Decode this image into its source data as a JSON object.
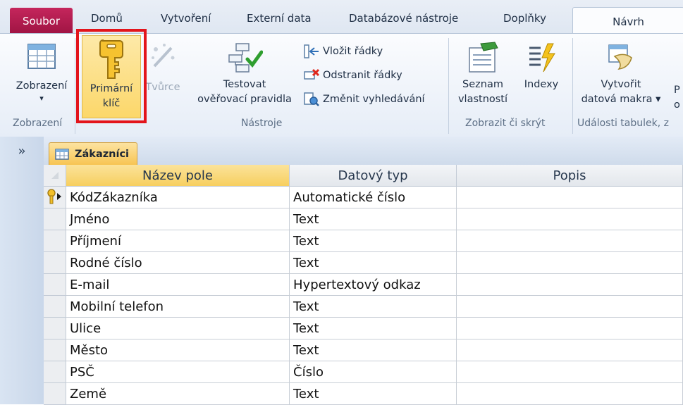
{
  "ribbon_tabs": {
    "file": "Soubor",
    "home": "Domů",
    "create": "Vytvoření",
    "external": "Externí data",
    "dbtools": "Databázové nástroje",
    "addins": "Doplňky",
    "design": "Návrh"
  },
  "ribbon": {
    "view": {
      "line1": "Zobrazení",
      "arrow": "▾",
      "group": "Zobrazení"
    },
    "primary_key": {
      "line1": "Primární",
      "line2": "klíč"
    },
    "builder": {
      "line1": "Tvůrce"
    },
    "test_rules": {
      "line1": "Testovat",
      "line2": "ověřovací pravidla"
    },
    "insert_rows": "Vložit řádky",
    "delete_rows": "Odstranit řádky",
    "modify_lookups": "Změnit vyhledávání",
    "tools_group": "Nástroje",
    "property_sheet": {
      "line1": "Seznam",
      "line2": "vlastností"
    },
    "indexes": {
      "line1": "Indexy"
    },
    "showhide_group": "Zobrazit či skrýt",
    "create_macros": {
      "line1": "Vytvořit",
      "line2": "datová makra ▾"
    },
    "cut_next_line1": "P",
    "cut_next_line2": "o",
    "events_group": "Události tabulek, z"
  },
  "nav": {
    "toggle": "»"
  },
  "document": {
    "tab_label": "Zákazníci"
  },
  "grid": {
    "headers": [
      "Název pole",
      "Datový typ",
      "Popis"
    ],
    "rows": [
      {
        "name": "KódZákazníka",
        "type": "Automatické číslo",
        "desc": "",
        "pk": true
      },
      {
        "name": "Jméno",
        "type": "Text",
        "desc": ""
      },
      {
        "name": "Příjmení",
        "type": "Text",
        "desc": ""
      },
      {
        "name": "Rodné číslo",
        "type": "Text",
        "desc": ""
      },
      {
        "name": "E-mail",
        "type": "Hypertextový odkaz",
        "desc": ""
      },
      {
        "name": "Mobilní telefon",
        "type": "Text",
        "desc": ""
      },
      {
        "name": "Ulice",
        "type": "Text",
        "desc": ""
      },
      {
        "name": "Město",
        "type": "Text",
        "desc": ""
      },
      {
        "name": "PSČ",
        "type": "Číslo",
        "desc": ""
      },
      {
        "name": "Země",
        "type": "Text",
        "desc": ""
      }
    ]
  },
  "colors": {
    "file_tab": "#b51a4f",
    "highlight_border": "#e3141b",
    "active_header": "#f9d574",
    "doc_tab": "#f7c553"
  }
}
